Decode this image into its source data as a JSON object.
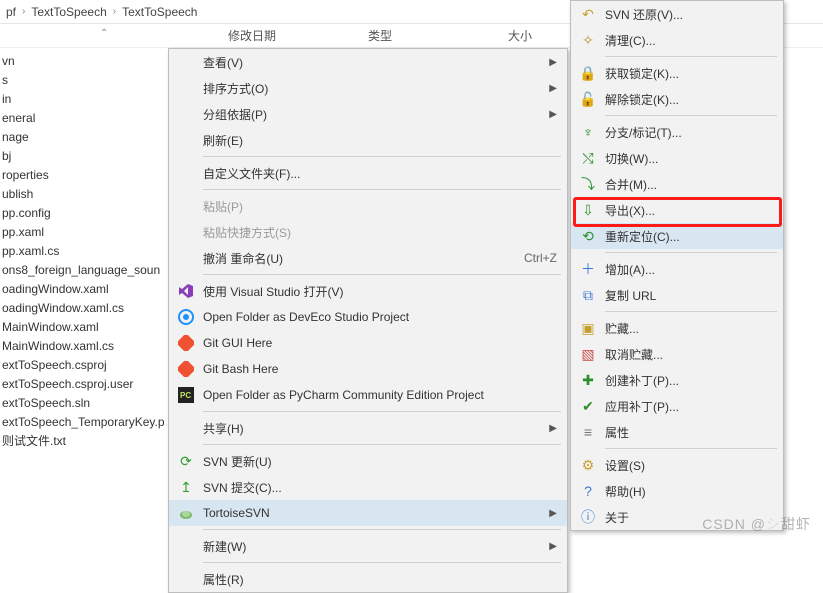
{
  "breadcrumb": {
    "a": "pf",
    "b": "TextToSpeech",
    "c": "TextToSpeech"
  },
  "headers": {
    "date": "修改日期",
    "type": "类型",
    "size": "大小"
  },
  "files": [
    "vn",
    "s",
    "in",
    "eneral",
    "nage",
    "bj",
    "roperties",
    "ublish",
    "pp.config",
    "pp.xaml",
    "pp.xaml.cs",
    "ons8_foreign_language_soun",
    "oadingWindow.xaml",
    "oadingWindow.xaml.cs",
    "MainWindow.xaml",
    "MainWindow.xaml.cs",
    "extToSpeech.csproj",
    "extToSpeech.csproj.user",
    "extToSpeech.sln",
    "extToSpeech_TemporaryKey.p",
    "则试文件.txt"
  ],
  "menu1": {
    "view": "查看(V)",
    "sort": "排序方式(O)",
    "group": "分组依据(P)",
    "refresh": "刷新(E)",
    "customize": "自定义文件夹(F)...",
    "paste": "粘贴(P)",
    "pasteShortcut": "粘贴快捷方式(S)",
    "undo": "撤消 重命名(U)",
    "undoKey": "Ctrl+Z",
    "openVS": "使用 Visual Studio 打开(V)",
    "openDevEco": "Open Folder as DevEco Studio Project",
    "gitGui": "Git GUI Here",
    "gitBash": "Git Bash Here",
    "openPyCharm": "Open Folder as PyCharm Community Edition Project",
    "share": "共享(H)",
    "svnUpdate": "SVN 更新(U)",
    "svnCommit": "SVN 提交(C)...",
    "tortoise": "TortoiseSVN",
    "new": "新建(W)",
    "properties": "属性(R)"
  },
  "menu2": {
    "top0": "...",
    "svnRevert": "SVN 还原(V)...",
    "clean": "清理(C)...",
    "getLock": "获取锁定(K)...",
    "releaseLock": "解除锁定(K)...",
    "branch": "分支/标记(T)...",
    "switch": "切换(W)...",
    "merge": "合并(M)...",
    "export": "导出(X)...",
    "relocate": "重新定位(C)...",
    "add": "增加(A)...",
    "copyUrl": "复制 URL",
    "shelve": "贮藏...",
    "unshelve": "取消贮藏...",
    "createPatch": "创建补丁(P)...",
    "applyPatch": "应用补丁(P)...",
    "props": "属性",
    "settings": "设置(S)",
    "help": "帮助(H)",
    "about": "关于"
  },
  "watermark": {
    "left": "CSDN @",
    "right": "甜虾"
  }
}
